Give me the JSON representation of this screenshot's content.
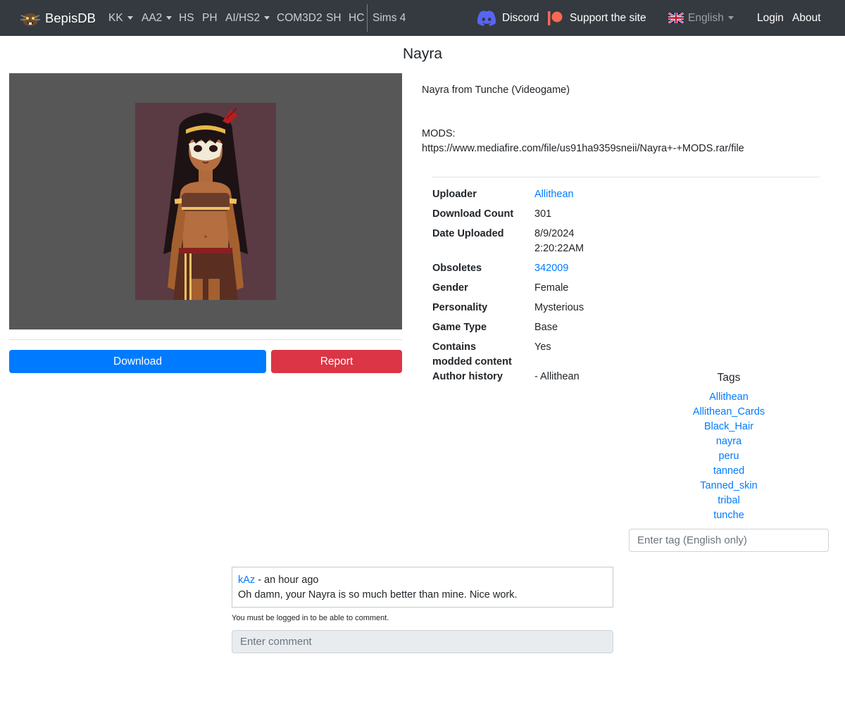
{
  "nav": {
    "brand": "BepisDB",
    "items": [
      {
        "label": "KK",
        "dropdown": true
      },
      {
        "label": "AA2",
        "dropdown": true
      },
      {
        "label": "HS"
      },
      {
        "label": "PH"
      },
      {
        "label": "AI/HS2",
        "dropdown": true
      },
      {
        "label": "COM3D2"
      },
      {
        "label": "SH"
      },
      {
        "label": "HC"
      },
      {
        "label": "Sims 4"
      }
    ],
    "discord": "Discord",
    "support": "Support the site",
    "language": "English",
    "login": "Login",
    "about": "About"
  },
  "card": {
    "title": "Nayra",
    "description_line1": "Nayra from Tunche (Videogame)",
    "description_line2": "MODS:",
    "description_line3": "https://www.mediafire.com/file/us91ha9359sneii/Nayra+-+MODS.rar/file"
  },
  "actions": {
    "download": "Download",
    "report": "Report"
  },
  "info": {
    "uploader_label": "Uploader",
    "uploader_value": "Allithean",
    "download_count_label": "Download Count",
    "download_count_value": "301",
    "date_label": "Date Uploaded",
    "date_value_1": "8/9/2024",
    "date_value_2": "2:20:22AM",
    "obsoletes_label": "Obsoletes",
    "obsoletes_value": "342009",
    "gender_label": "Gender",
    "gender_value": "Female",
    "personality_label": "Personality",
    "personality_value": "Mysterious",
    "game_type_label": "Game Type",
    "game_type_value": "Base",
    "modded_label_1": "Contains",
    "modded_label_2": "modded content",
    "modded_value": "Yes",
    "author_history_label": "Author history",
    "author_history_value": "- Allithean"
  },
  "tags": {
    "title": "Tags",
    "items": [
      "Allithean",
      "Allithean_Cards",
      "Black_Hair",
      "nayra",
      "peru",
      "tanned",
      "Tanned_skin",
      "tribal",
      "tunche"
    ],
    "input_placeholder": "Enter tag (English only)"
  },
  "comments": {
    "items": [
      {
        "author": "kAz",
        "time": " - an hour ago",
        "text": "Oh damn, your Nayra is so much better than mine. Nice work."
      }
    ],
    "login_note": "You must be logged in to be able to comment.",
    "input_placeholder": "Enter comment"
  },
  "colors": {
    "navbar": "#343a40",
    "primary": "#007bff",
    "danger": "#dc3545",
    "discord": "#5865f2",
    "patreon": "#f96854"
  }
}
